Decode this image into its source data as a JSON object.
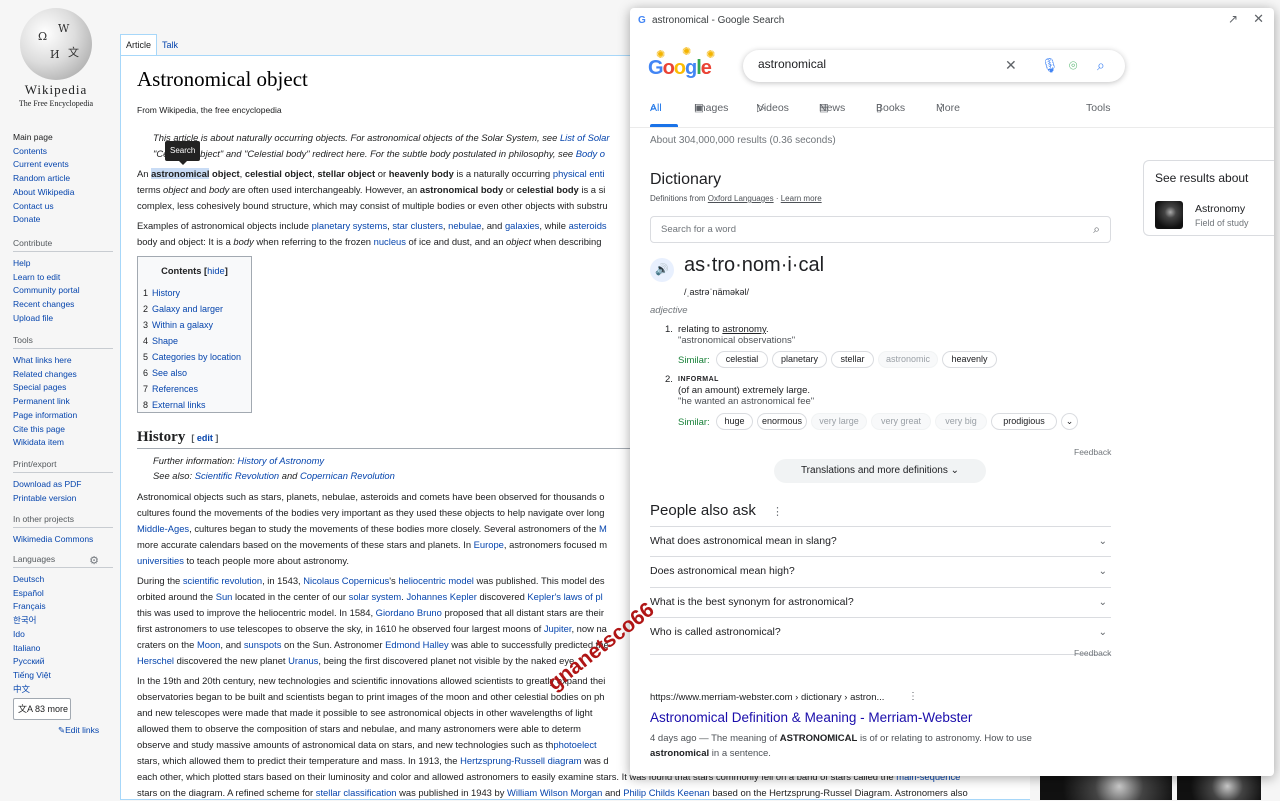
{
  "wikipedia": {
    "wordmark": "Wikipedia",
    "tagline": "The Free Encyclopedia",
    "nav": [
      "Main page",
      "Contents",
      "Current events",
      "Random article",
      "About Wikipedia",
      "Contact us",
      "Donate"
    ],
    "contribute": {
      "heading": "Contribute",
      "items": [
        "Help",
        "Learn to edit",
        "Community portal",
        "Recent changes",
        "Upload file"
      ]
    },
    "tools": {
      "heading": "Tools",
      "items": [
        "What links here",
        "Related changes",
        "Special pages",
        "Permanent link",
        "Page information",
        "Cite this page",
        "Wikidata item"
      ]
    },
    "print": {
      "heading": "Print/export",
      "items": [
        "Download as PDF",
        "Printable version"
      ]
    },
    "projects": {
      "heading": "In other projects",
      "items": [
        "Wikimedia Commons"
      ]
    },
    "languages": {
      "heading": "Languages",
      "items": [
        "Deutsch",
        "Español",
        "Français",
        "한국어",
        "Ido",
        "Italiano",
        "Русский",
        "Tiếng Việt",
        "中文"
      ],
      "more": "83 more",
      "edit_links": "Edit links"
    },
    "tabs": {
      "article": "Article",
      "talk": "Talk"
    },
    "title": "Astronomical object",
    "subtitle": "From Wikipedia, the free encyclopedia",
    "tooltip": "Search",
    "hatnote1": {
      "a": "This article is about naturally occurring objects. For astronomical objects of the Solar System, see ",
      "link": "List of Solar"
    },
    "hatnote2": {
      "a": "\"Celestial object\" and \"Celestial body\" redirect here. For the subtle body postulated in philosophy, see ",
      "link": "Body o"
    },
    "intro": {
      "l1a": "An ",
      "l1hl": "astronomical",
      "l1b": " object",
      "l1c": ", ",
      "l1d": "celestial object",
      "l1e": ", ",
      "l1f": "stellar object",
      "l1g": " or ",
      "l1h": "heavenly body",
      "l1i": " is a naturally occurring ",
      "l1link": "physical enti",
      "l2a": "terms ",
      "l2b": "object",
      "l2c": " and ",
      "l2d": "body",
      "l2e": " are often used interchangeably. However, an ",
      "l2f": "astronomical body",
      "l2g": " or ",
      "l2h": "celestial body",
      "l2i": " is a si",
      "l3": "complex, less cohesively bound structure, which may consist of multiple bodies or even other objects with substru"
    },
    "examples": {
      "a": "Examples of astronomical objects include ",
      "l1": "planetary systems",
      ",": ", ",
      "l2": "star clusters",
      "l3": "nebulae",
      "b": ", and ",
      "l4": "galaxies",
      "c": ", while ",
      "l5": "asteroids",
      "d": "body and object: It is a ",
      "e": "body",
      "f": " when referring to the frozen ",
      "l6": "nucleus",
      "g": " of ice and dust, and an ",
      "h": "object",
      "i": " when describing"
    },
    "toc": {
      "title": "Contents",
      "hide": "hide",
      "items": [
        {
          "n": "1",
          "t": "History"
        },
        {
          "n": "2",
          "t": "Galaxy and larger"
        },
        {
          "n": "3",
          "t": "Within a galaxy"
        },
        {
          "n": "4",
          "t": "Shape"
        },
        {
          "n": "5",
          "t": "Categories by location"
        },
        {
          "n": "6",
          "t": "See also"
        },
        {
          "n": "7",
          "t": "References"
        },
        {
          "n": "8",
          "t": "External links"
        }
      ]
    },
    "history": {
      "heading": "History",
      "edit": "edit",
      "further_a": "Further information: ",
      "further_link": "History of Astronomy",
      "see_a": "See also: ",
      "see_l1": "Scientific Revolution",
      "see_b": " and ",
      "see_l2": "Copernican Revolution",
      "p1": {
        "l1": "Astronomical objects such as stars, planets, nebulae, asteroids and comets have been observed for thousands o",
        "l2": "cultures found the movements of the bodies very important as they used these objects to help navigate over long",
        "l3link": "Middle-Ages",
        "l3": ", cultures began to study the movements of these bodies more closely. Several astronomers of the ",
        "l3b": "M",
        "l4": "more accurate calendars based on the movements of these stars and planets. In ",
        "l4link": "Europe",
        "l4b": ", astronomers focused m",
        "l5link": "universities",
        "l5": " to teach people more about astronomy."
      },
      "p2": {
        "a": "During the ",
        "l1": "scientific revolution",
        "b": ", in 1543, ",
        "l2": "Nicolaus Copernicus",
        "c": "'s ",
        "l3": "heliocentric model",
        "d": " was published. This model des",
        "e": "orbited around the ",
        "l4": "Sun",
        "f": " located in the center of our ",
        "l5": "solar system",
        "g": ". ",
        "l6": "Johannes Kepler",
        "h": " discovered ",
        "l7": "Kepler's laws of pl",
        "i": "this was used to improve the heliocentric model. In 1584, ",
        "l8": "Giordano Bruno",
        "j": " proposed that all distant stars are their",
        "k": "first astronomers to use telescopes to observe the sky, in 1610 he observed four largest moons of ",
        "l9": "Jupiter",
        "k2": ", now na",
        "m": "craters on the ",
        "l10": "Moon",
        "n": ", and ",
        "l11": "sunspots",
        "o": " on the Sun. Astronomer ",
        "l12": "Edmond Halley",
        "p": " was able to successfully predicted the",
        "l13": "Herschel",
        "q": " discovered the new planet ",
        "l14": "Uranus",
        "r": ", being the first discovered planet not visible by the naked eye."
      },
      "p3": {
        "l1": "In the 19th and 20th century, new technologies and scientific innovations allowed scientists to greatly expand thei",
        "l2": "observatories began to be built and scientists began to print images of the moon and other celestial bodies on ph",
        "l3": "and new telescopes were made that made it possible to see astronomical objects in other wavelengths of light",
        "l4": "allowed them to observe the composition of stars and nebulae, and many astronomers were able to determ",
        "l5": "observe and study massive amounts of astronomical data on stars, and new technologies such as th",
        "l5link": "photoelect",
        "l6a": "stars, which allowed them to predict their temperature and mass. In 1913, the ",
        "l6link": "Hertzsprung-Russell diagram",
        "l6b": " was d",
        "l7a": "each other, which plotted stars based on their luminosity and color and allowed astronomers to easily examine stars. It was found that stars commonly fell on a band of stars called the ",
        "l7link": "main-sequence",
        "l8a": "stars on the diagram. A refined scheme for ",
        "l8l1": "stellar classification",
        "l8b": " was published in 1943 by ",
        "l8l2": "William Wilson Morgan",
        "l8c": " and ",
        "l8l3": "Philip Childs Keenan",
        "l8d": " based on the Hertzsprung-Russel Diagram. Astronomers also"
      }
    }
  },
  "google": {
    "window_title": "astronomical - Google Search",
    "query": "astronomical",
    "tabs": [
      "All",
      "Images",
      "Videos",
      "News",
      "Books",
      "More"
    ],
    "tools": "Tools",
    "result_count": "About 304,000,000 results (0.36 seconds)",
    "dictionary": {
      "heading": "Dictionary",
      "src_a": "Definitions from ",
      "src_link": "Oxford Languages",
      "src_sep": " · ",
      "src_learn": "Learn more",
      "search_placeholder": "Search for a word",
      "headword": "as·tro·nom·i·cal",
      "phonetic": "/ˌastrəˈnäməkəl/",
      "pos": "adjective",
      "sense1": {
        "n": "1.",
        "a": "relating to ",
        "link": "astronomy",
        "b": ".",
        "example": "\"astronomical observations\""
      },
      "sense2": {
        "n": "2.",
        "label": "INFORMAL",
        "def": "(of an amount) extremely large.",
        "example": "\"he wanted an astronomical fee\""
      },
      "similar_label": "Similar:",
      "similar1": [
        "celestial",
        "planetary",
        "stellar",
        "astronomic",
        "heavenly"
      ],
      "similar2": [
        "huge",
        "enormous",
        "very large",
        "very great",
        "very big",
        "prodigious"
      ],
      "feedback": "Feedback",
      "more": "Translations and more definitions"
    },
    "paa": {
      "heading": "People also ask",
      "questions": [
        "What does astronomical mean in slang?",
        "Does astronomical mean high?",
        "What is the best synonym for astronomical?",
        "Who is called astronomical?"
      ],
      "feedback": "Feedback"
    },
    "result": {
      "cite": "https://www.merriam-webster.com › dictionary › astron...",
      "title": "Astronomical Definition & Meaning - Merriam-Webster",
      "date": "4 days ago",
      "sep": " — The meaning of ",
      "b1": "ASTRONOMICAL",
      "mid": " is of or relating to astronomy. How to use",
      "b2": "astronomical",
      "end": " in a sentence."
    },
    "see_results": {
      "heading": "See results about",
      "name": "Astronomy",
      "subtitle": "Field of study"
    }
  },
  "watermark": "gnanetsco66"
}
